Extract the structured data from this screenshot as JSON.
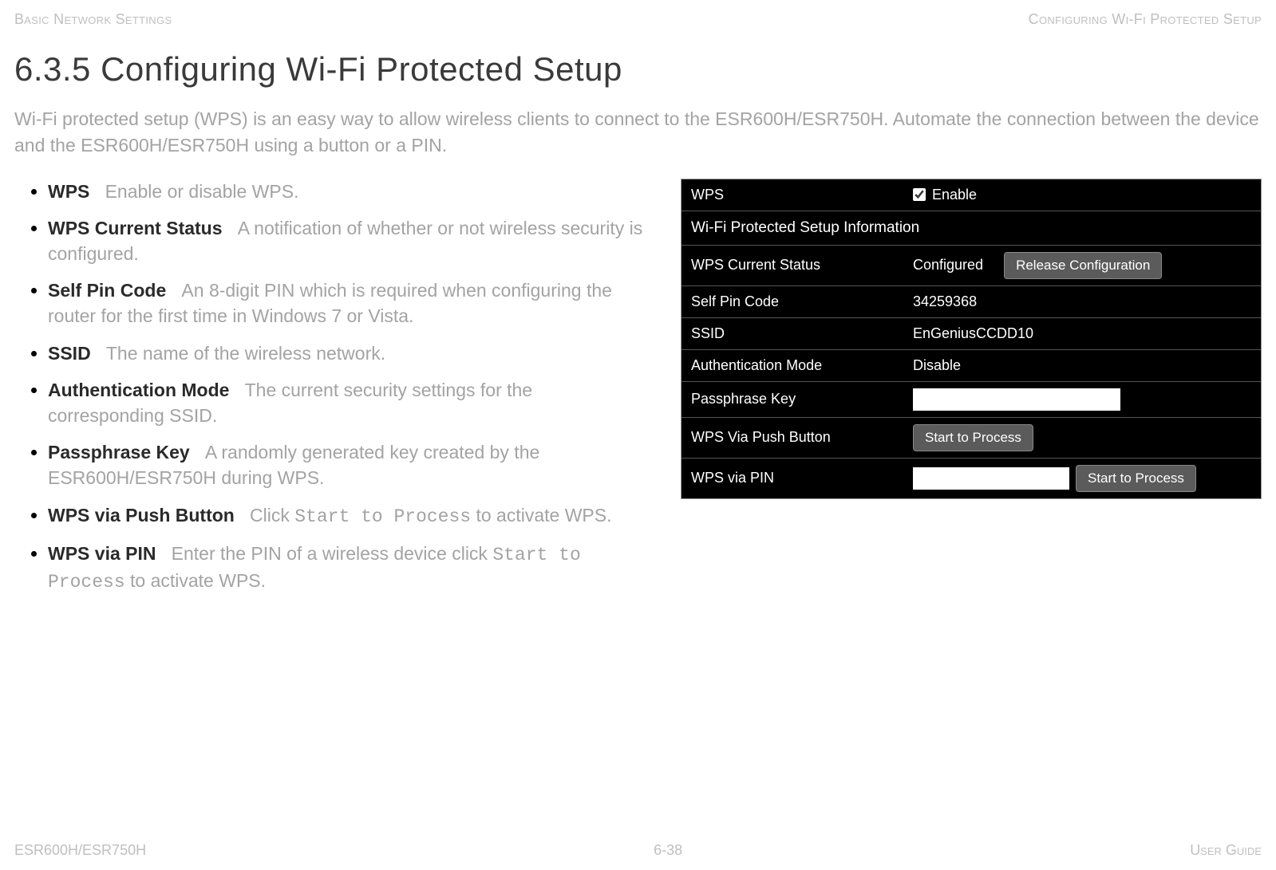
{
  "header": {
    "left": "Basic Network Settings",
    "right": "Configuring Wi-Fi Protected Setup"
  },
  "title": "6.3.5 Configuring Wi-Fi Protected Setup",
  "intro": "Wi-Fi protected setup (WPS) is an easy way to allow wireless clients to connect to the ESR600H/ESR750H. Automate the connection between the device and the ESR600H/ESR750H using a button or a PIN.",
  "definitions": [
    {
      "term": "WPS",
      "desc": "Enable or disable WPS."
    },
    {
      "term": "WPS Current Status",
      "desc": "A notification of whether or not wireless security is configured."
    },
    {
      "term": "Self Pin Code",
      "desc": "An 8-digit PIN which is required when configuring the router for the first time in Windows 7 or Vista."
    },
    {
      "term": "SSID",
      "desc": "The name of the wireless network."
    },
    {
      "term": "Authentication Mode",
      "desc": "The current security settings for the corresponding SSID."
    },
    {
      "term": "Passphrase Key",
      "desc": "A randomly generated key created by the ESR600H/ESR750H during WPS."
    },
    {
      "term": "WPS via Push Button",
      "desc_pre": "Click ",
      "code": "Start to Process",
      "desc_post": " to activate WPS."
    },
    {
      "term": "WPS via PIN",
      "desc_pre": "Enter the PIN of a wireless device click ",
      "code": "Start to Process",
      "desc_post": " to activate WPS."
    }
  ],
  "panel": {
    "wps_label": "WPS",
    "enable_label": "Enable",
    "section_header": "Wi-Fi Protected Setup Information",
    "rows": {
      "current_status_label": "WPS Current Status",
      "current_status_value": "Configured",
      "release_btn": "Release Configuration",
      "self_pin_label": "Self Pin Code",
      "self_pin_value": "34259368",
      "ssid_label": "SSID",
      "ssid_value": "EnGeniusCCDD10",
      "auth_label": "Authentication Mode",
      "auth_value": "Disable",
      "passphrase_label": "Passphrase Key",
      "passphrase_value": "",
      "push_label": "WPS Via Push Button",
      "push_btn": "Start to Process",
      "pin_label": "WPS via PIN",
      "pin_value": "",
      "pin_btn": "Start to Process"
    }
  },
  "footer": {
    "left": "ESR600H/ESR750H",
    "center": "6-38",
    "right": "User Guide"
  }
}
